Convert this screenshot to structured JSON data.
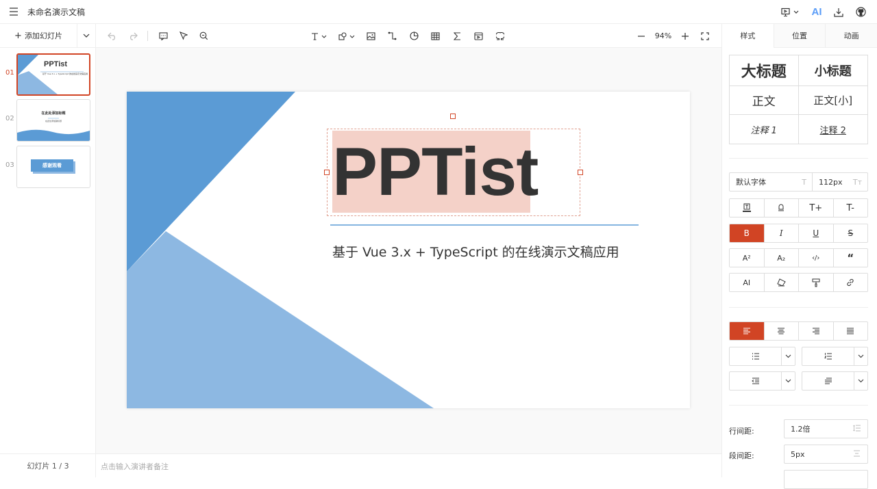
{
  "app": {
    "doc_title": "未命名演示文稿",
    "ai_label": "AI"
  },
  "left": {
    "add_slide": "添加幻灯片",
    "slide_numbers": [
      "01",
      "02",
      "03"
    ],
    "thumb1": {
      "title": "PPTist",
      "subtitle": "基于 Vue 3.x + TypeScript 的在线演示文稿应用"
    },
    "thumb2": {
      "title": "在此处添加标题",
      "subtitle": "在此处添加副标题"
    },
    "thumb3": {
      "title": "感谢观看"
    },
    "footer": "幻灯片 1 / 3"
  },
  "toolbar": {
    "zoom": "94%"
  },
  "slide": {
    "title": "PPTist",
    "subtitle": "基于 Vue 3.x + TypeScript 的在线演示文稿应用",
    "colors": {
      "dark_blue": "#5b9bd5",
      "light_blue": "#8db8e2",
      "title_highlight": "#f4d1c8",
      "line": "#5b9bd5"
    }
  },
  "notes": {
    "placeholder": "点击输入演讲者备注"
  },
  "right": {
    "tabs": [
      "样式",
      "位置",
      "动画"
    ],
    "presets": [
      "大标题",
      "小标题",
      "正文",
      "正文[小]",
      "注释 1",
      "注释 2"
    ],
    "font_family": "默认字体",
    "font_size": "112px",
    "line_height_label": "行间距:",
    "line_height_value": "1.2倍",
    "para_spacing_label": "段间距:",
    "para_spacing_value": "5px",
    "format_buttons": [
      "B",
      "I",
      "U",
      "S"
    ],
    "script_buttons": [
      "A²",
      "A₂",
      "‹/›",
      "“"
    ],
    "ai_button": "AI",
    "accent": "#d14424"
  }
}
